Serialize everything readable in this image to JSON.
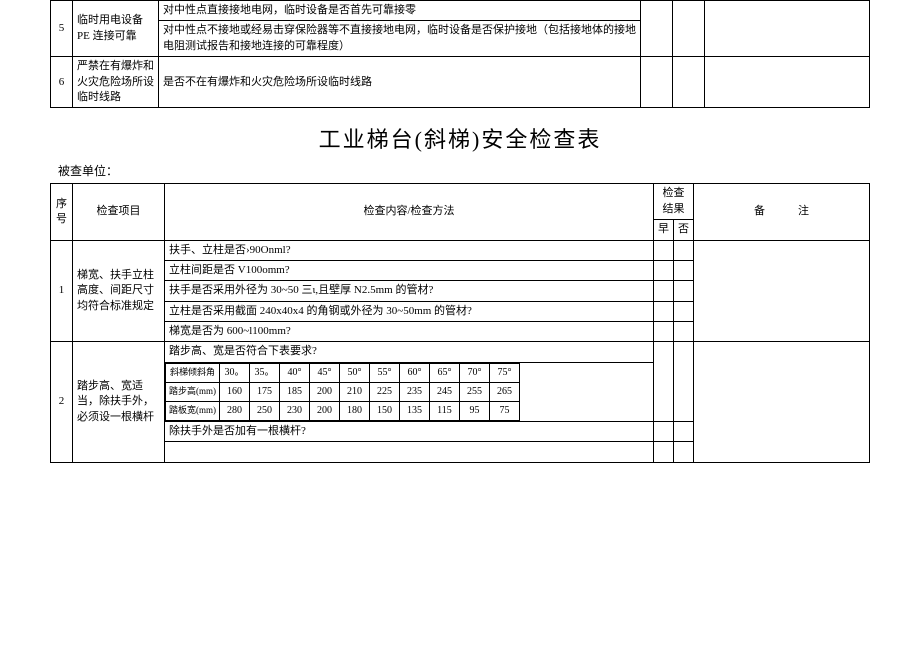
{
  "topTable": {
    "rows": [
      {
        "seq": "5",
        "item": "临时用电设备 PE 连接可靠",
        "contents": [
          "对中性点直接接地电网，临时设备是否首先可靠接零",
          "对中性点不接地或经易击穿保险器等不直接接地电网，临时设备是否保护接地（包括接地体的接地电阻测试报告和接地连接的可靠程度）"
        ]
      },
      {
        "seq": "6",
        "item": "严禁在有爆炸和火灾危险场所设临时线路",
        "contents": [
          "是否不在有爆炸和火灾危险场所设临时线路"
        ]
      }
    ]
  },
  "title": "工业梯台(斜梯)安全检查表",
  "unitLabel": "被查单位：",
  "mainHeader": {
    "seq": "序号",
    "item": "检查项目",
    "content": "检查内容/检查方法",
    "result": "检查结果",
    "yes": "早",
    "no": "否",
    "note": "备　　　注"
  },
  "mainRows": [
    {
      "seq": "1",
      "item": "梯宽、扶手立柱高度、间距尺寸均符合标准规定",
      "contents": [
        "扶手、立柱是否›90Onml?",
        "立柱间距是否 V100omm?",
        "扶手是否采用外径为 30~50 三ι,且壁厚 N2.5mm 的管材?",
        "立柱是否采用截面 240x40x4 的角钢或外径为 30~50mm 的管材?",
        "梯宽是否为 600~l100mm?"
      ]
    },
    {
      "seq": "2",
      "item": "踏步高、宽适当，除扶手外，必须设一根横杆",
      "pre": "踏步高、宽是否符合下表要求?",
      "nested": {
        "headers": [
          "斜梯倾斜角",
          "踏步高(mm)",
          "踏板宽(mm)"
        ],
        "angles": [
          "30。",
          "35。",
          "40°",
          "45°",
          "50°",
          "55°",
          "60°",
          "65°",
          "70°",
          "75°"
        ],
        "stepH": [
          "160",
          "175",
          "185",
          "200",
          "210",
          "225",
          "235",
          "245",
          "255",
          "265"
        ],
        "stepW": [
          "280",
          "250",
          "230",
          "200",
          "180",
          "150",
          "135",
          "115",
          "95",
          "75"
        ]
      },
      "post": "除扶手外是否加有一根横杆?"
    }
  ]
}
